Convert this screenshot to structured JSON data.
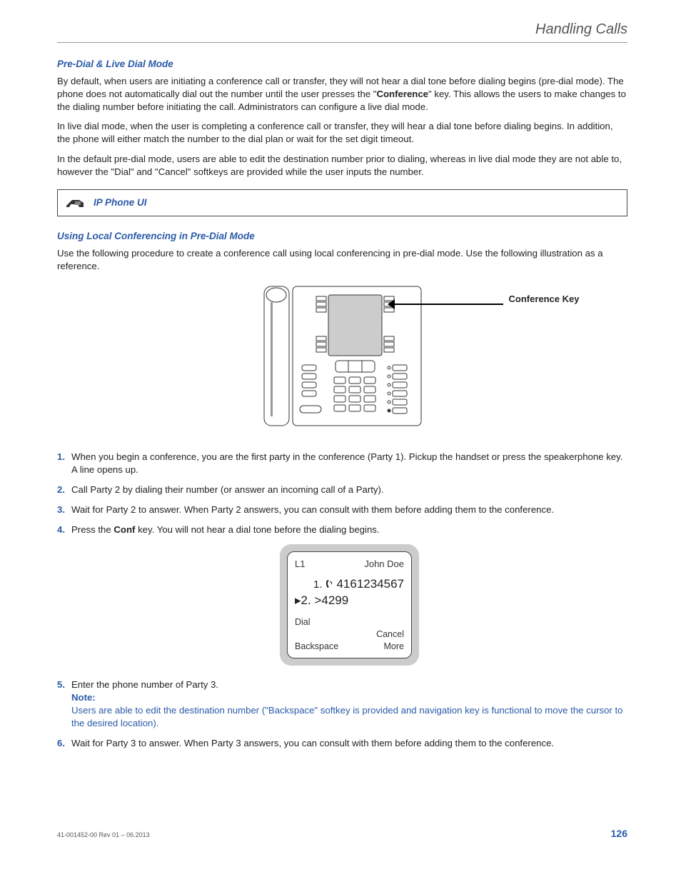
{
  "header": {
    "title": "Handling Calls"
  },
  "section1": {
    "heading": "Pre-Dial & Live Dial Mode",
    "p1a": "By default, when users are initiating a conference call or transfer, they will not hear a dial tone before dialing begins (pre-dial mode). The phone does not automatically dial out the number until the user presses the \"",
    "p1bold": "Conference",
    "p1b": "\" key. This allows the users to make changes to the dialing number before initiating the call.  Administrators can configure a live dial mode.",
    "p2": "In live dial mode, when the user is completing a conference call or transfer, they will hear a dial tone before dialing begins. In addition, the phone will either match the number to the dial plan or wait for the set digit timeout.",
    "p3": "In the default pre-dial mode, users are able to edit the destination number prior to dialing, whereas in live dial mode they are not able to, however the \"Dial\" and \"Cancel\" softkeys are provided while the user inputs the number."
  },
  "callout": {
    "label": "IP Phone UI"
  },
  "section2": {
    "heading": "Using Local Conferencing in Pre-Dial Mode",
    "intro": "Use the following procedure to create a conference call using local conferencing in pre-dial mode. Use the following illustration as a reference."
  },
  "diagram": {
    "arrow_label": "Conference Key"
  },
  "steps": {
    "s1": "When you begin a conference, you are the first party in the conference (Party 1). Pickup the handset or press the speakerphone key. A line opens up.",
    "s2": "Call Party 2 by dialing their number (or answer an incoming call of a Party).",
    "s3": "Wait for Party 2 to answer. When Party 2 answers, you can consult with them before adding them to the conference.",
    "s4a": "Press the ",
    "s4bold": "Conf",
    "s4b": " key. You will not hear a dial tone before the dialing begins.",
    "s5_main": "Enter the phone number of Party 3.",
    "s5_note_label": "Note:",
    "s5_note_text": "Users are able to edit the destination number (\"Backspace\" softkey is provided and navigation key is functional to move the cursor to the desired location).",
    "s6": "Wait for Party 3 to answer. When Party 3 answers, you can consult with them before adding them to the conference."
  },
  "phone_screen": {
    "line_label": "L1",
    "caller_name": "John Doe",
    "row1": "1.   4161234567",
    "row2": "▸2. >4299",
    "sk_dial": "Dial",
    "sk_backspace": "Backspace",
    "sk_cancel": "Cancel",
    "sk_more": "More"
  },
  "footer": {
    "left": "41-001452-00 Rev 01 – 06.2013",
    "page": "126"
  }
}
